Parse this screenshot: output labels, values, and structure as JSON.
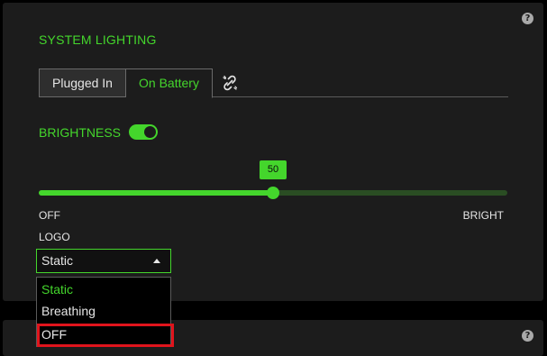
{
  "section": {
    "title": "SYSTEM LIGHTING",
    "help_icon": "?"
  },
  "tabs": [
    {
      "label": "Plugged In",
      "selected": false
    },
    {
      "label": "On Battery",
      "selected": true
    }
  ],
  "link_icon": "unlink-icon",
  "brightness": {
    "label": "BRIGHTNESS",
    "toggle_on": true,
    "value": 50,
    "value_label": "50",
    "min": 0,
    "max": 100,
    "min_label": "OFF",
    "max_label": "BRIGHT"
  },
  "logo": {
    "label": "LOGO",
    "selected": "Static",
    "options": [
      "Static",
      "Breathing",
      "OFF"
    ]
  },
  "panel2": {
    "help_icon": "?"
  },
  "colors": {
    "accent": "#44d62c",
    "panel": "#1c1c1c",
    "highlight": "#e0141c"
  }
}
